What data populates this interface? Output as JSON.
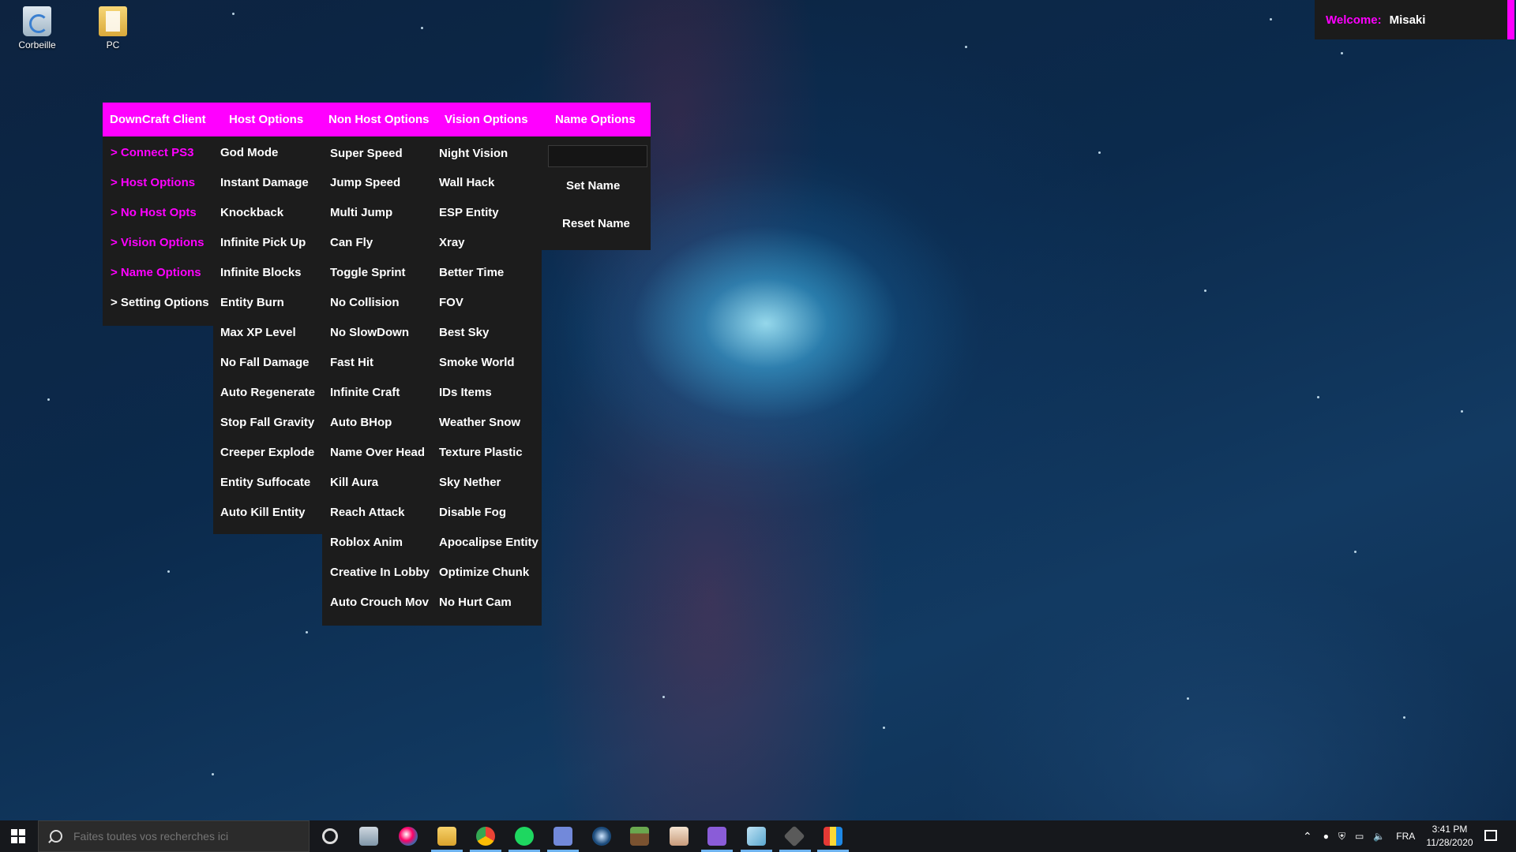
{
  "desktop": {
    "icons": [
      {
        "label": "Corbeille",
        "icon": "recycle-bin-icon"
      },
      {
        "label": "PC",
        "icon": "this-pc-icon"
      }
    ]
  },
  "welcome": {
    "label": "Welcome:",
    "user": "Misaki"
  },
  "menu": {
    "tabs": [
      "DownCraft Client",
      "Host Options",
      "Non Host Options",
      "Vision Options",
      "Name Options"
    ],
    "client_items": [
      "> Connect PS3",
      "> Host Options",
      "> No Host Opts",
      "> Vision Options",
      "> Name Options",
      "> Setting Options"
    ],
    "host_options": [
      "God Mode",
      "Instant Damage",
      "Knockback",
      "Infinite Pick Up",
      "Infinite Blocks",
      "Entity Burn",
      "Max XP Level",
      "No Fall Damage",
      "Auto Regenerate",
      "Stop Fall Gravity",
      "Creeper Explode",
      "Entity Suffocate",
      "Auto Kill Entity"
    ],
    "non_host_options": [
      "Super Speed",
      "Jump Speed",
      "Multi Jump",
      "Can Fly",
      "Toggle Sprint",
      "No Collision",
      "No SlowDown",
      "Fast Hit",
      "Infinite Craft",
      "Auto BHop",
      "Name Over Head",
      "Kill Aura",
      "Reach Attack",
      "Roblox Anim",
      "Creative In Lobby",
      "Auto Crouch Mov"
    ],
    "vision_options": [
      "Night Vision",
      "Wall Hack",
      "ESP Entity",
      "Xray",
      "Better Time",
      "FOV",
      "Best Sky",
      "Smoke World",
      "IDs Items",
      "Weather Snow",
      "Texture Plastic",
      "Sky Nether",
      "Disable Fog",
      "Apocalipse Entity",
      "Optimize Chunk",
      "No Hurt Cam"
    ],
    "name_options": {
      "input_value": "",
      "set_label": "Set Name",
      "reset_label": "Reset Name"
    },
    "accent_color": "#ff00ff",
    "panel_color": "#1c1c1c"
  },
  "taskbar": {
    "search_placeholder": "Faites toutes vos recherches ici",
    "pinned": [
      "settings-gear-icon",
      "photos-icon",
      "paint-icon",
      "file-explorer-icon",
      "chrome-icon",
      "spotify-icon",
      "discord-icon",
      "steam-icon",
      "minecraft-icon",
      "app-icon",
      "visual-studio-icon",
      "notes-icon",
      "cube-app-icon",
      "media-icon"
    ],
    "language": "FRA",
    "time": "3:41 PM",
    "date": "11/28/2020"
  }
}
